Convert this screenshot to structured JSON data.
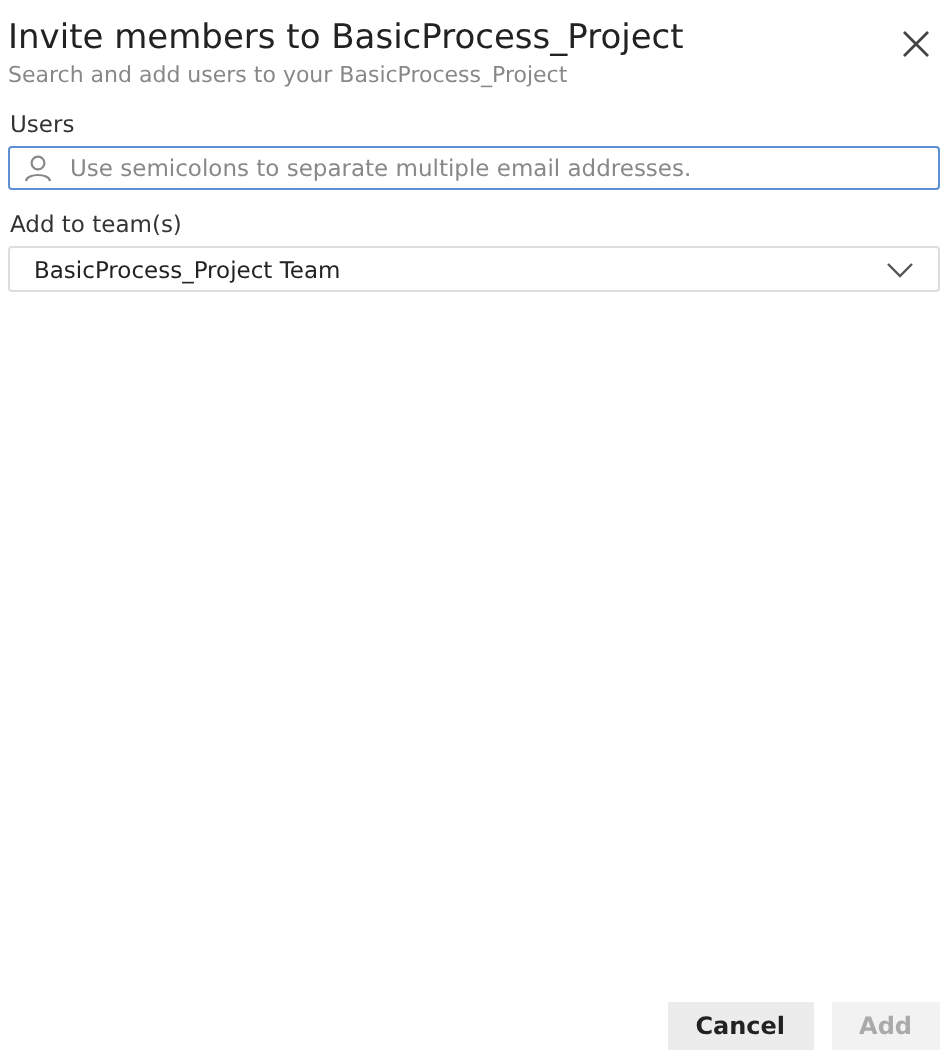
{
  "dialog": {
    "title": "Invite members to BasicProcess_Project",
    "subtitle": "Search and add users to your BasicProcess_Project"
  },
  "users": {
    "label": "Users",
    "placeholder": "Use semicolons to separate multiple email addresses.",
    "focused": true
  },
  "team": {
    "label": "Add to team(s)",
    "value": "BasicProcess_Project Team"
  },
  "buttons": [
    {
      "label": "Cancel",
      "disabled": false
    },
    {
      "label": "Add",
      "disabled": true
    }
  ]
}
